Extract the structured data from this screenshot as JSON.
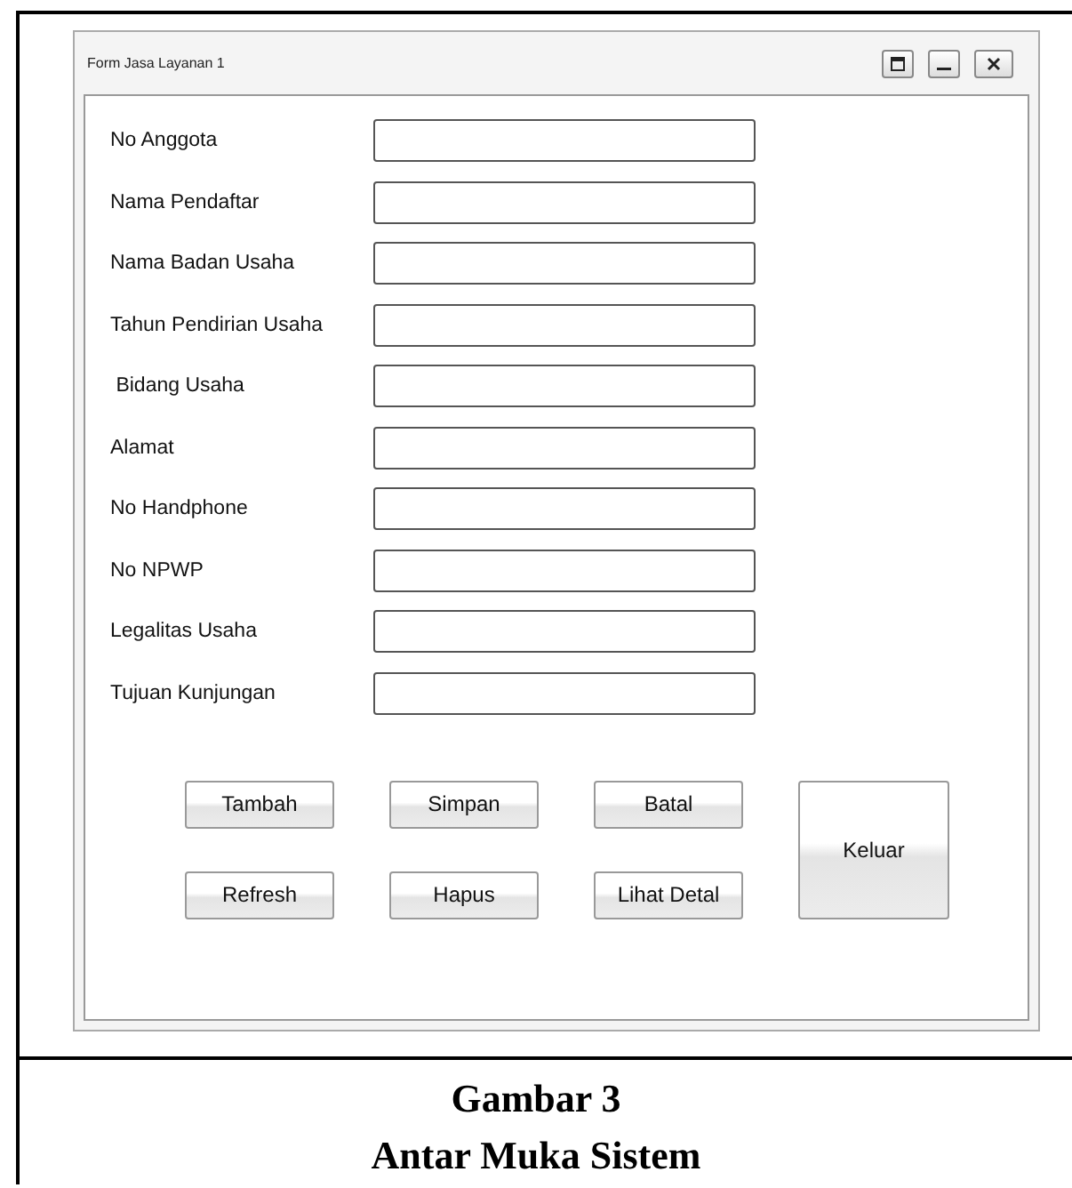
{
  "window": {
    "title": "Form Jasa Layanan 1",
    "controls": [
      {
        "kind": "maximize"
      },
      {
        "kind": "minimize"
      },
      {
        "kind": "close"
      }
    ]
  },
  "fields": [
    {
      "label": "No Anggota"
    },
    {
      "label": "Nama Pendaftar"
    },
    {
      "label": "Nama Badan Usaha"
    },
    {
      "label": "Tahun Pendirian Usaha"
    },
    {
      "label": " Bidang Usaha"
    },
    {
      "label": "Alamat"
    },
    {
      "label": "No Handphone"
    },
    {
      "label": "No NPWP"
    },
    {
      "label": "Legalitas Usaha"
    },
    {
      "label": "Tujuan Kunjungan"
    }
  ],
  "buttons": [
    {
      "label": "Tambah",
      "kind": "normal"
    },
    {
      "label": "Simpan",
      "kind": "normal"
    },
    {
      "label": "Batal",
      "kind": "normal"
    },
    {
      "label": "Keluar",
      "kind": "tall"
    },
    {
      "label": "Refresh",
      "kind": "normal"
    },
    {
      "label": "Hapus",
      "kind": "normal"
    },
    {
      "label": "Lihat Detal",
      "kind": "normal"
    }
  ],
  "caption": [
    "Gambar 3",
    "Antar Muka Sistem"
  ]
}
